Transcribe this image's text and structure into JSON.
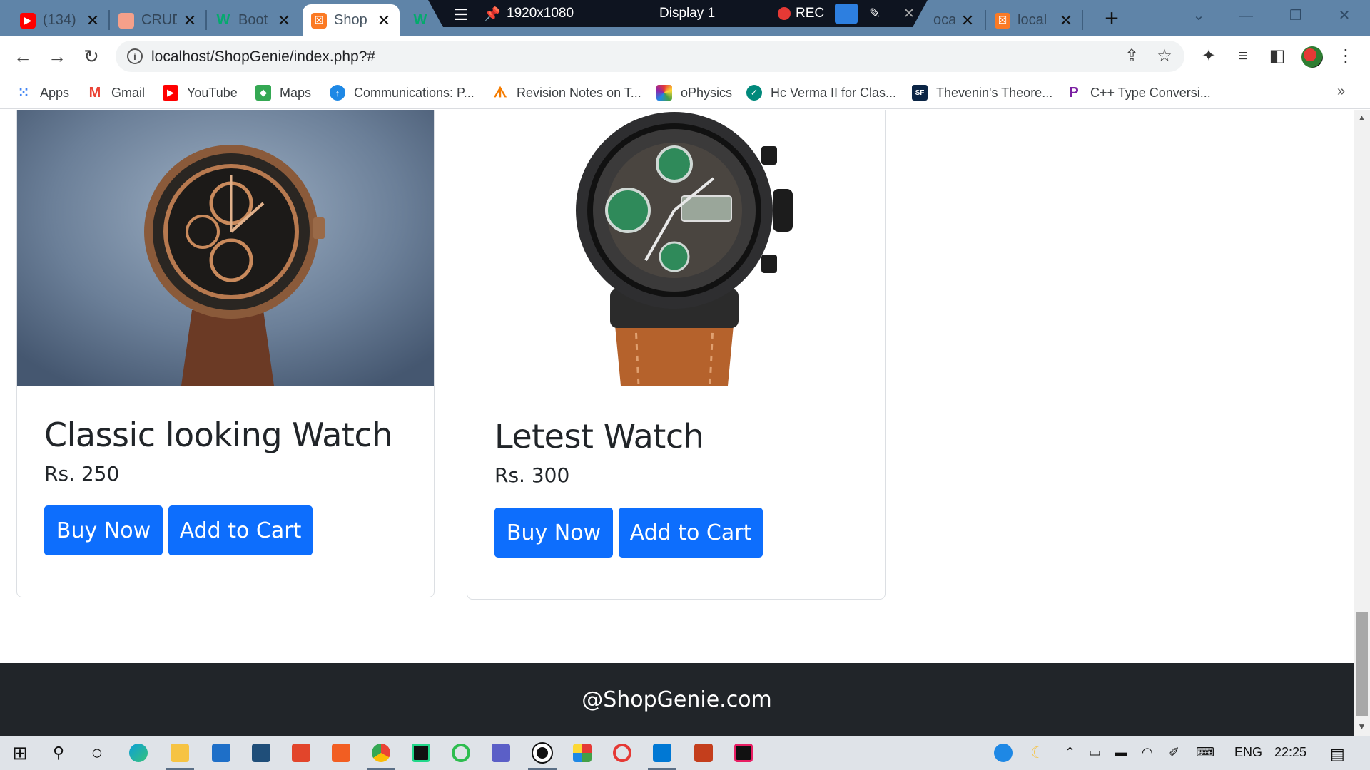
{
  "browser": {
    "tabs": [
      {
        "title": "(134)",
        "favicon": "youtube-icon",
        "color": "#ff0000"
      },
      {
        "title": "CRUD",
        "favicon": "page-icon",
        "color": "#f5a08a"
      },
      {
        "title": "Boot",
        "favicon": "w3schools-icon",
        "color": "#04aa6d"
      },
      {
        "title": "Shop",
        "favicon": "xampp-icon",
        "color": "#fb7a24"
      },
      {
        "title": "",
        "favicon": "w3schools-icon",
        "color": "#04aa6d"
      },
      {
        "title": "ocal",
        "favicon": "page-icon",
        "color": "#5f84a8"
      },
      {
        "title": "local",
        "favicon": "xampp-icon",
        "color": "#fb7a24"
      }
    ],
    "recorder": {
      "resolution": "1920x1080",
      "display": "Display 1",
      "rec_label": "REC"
    },
    "url": "localhost/ShopGenie/index.php?#",
    "bookmarks": [
      {
        "label": "Apps",
        "icon": "apps-grid-icon",
        "color": "#4285f4"
      },
      {
        "label": "Gmail",
        "icon": "gmail-icon",
        "color": "#ea4335"
      },
      {
        "label": "YouTube",
        "icon": "youtube-icon",
        "color": "#ff0000"
      },
      {
        "label": "Maps",
        "icon": "maps-icon",
        "color": "#34a853"
      },
      {
        "label": "Communications: P...",
        "icon": "upload-icon",
        "color": "#1e88e5"
      },
      {
        "label": "Revision Notes on T...",
        "icon": "revision-icon",
        "color": "#f57c00"
      },
      {
        "label": "oPhysics",
        "icon": "ophysics-icon",
        "color": "#8e24aa"
      },
      {
        "label": "Hc Verma II for Clas...",
        "icon": "check-circle-icon",
        "color": "#00897b"
      },
      {
        "label": "Thevenin's Theore...",
        "icon": "sf-icon",
        "color": "#0b2545"
      },
      {
        "label": "C++ Type Conversi...",
        "icon": "p-icon",
        "color": "#7b1fa2"
      }
    ]
  },
  "products": [
    {
      "title": "Classic looking Watch",
      "price": "Rs. 250",
      "buy_label": "Buy Now",
      "cart_label": "Add to Cart"
    },
    {
      "title": "Letest Watch",
      "price": "Rs. 300",
      "buy_label": "Buy Now",
      "cart_label": "Add to Cart"
    }
  ],
  "footer": {
    "text": "@ShopGenie.com"
  },
  "taskbar": {
    "language": "ENG",
    "time": "22:25"
  },
  "colors": {
    "primary": "#0d6efd",
    "footer_bg": "#212529",
    "tab_strip": "#5f84a8"
  }
}
